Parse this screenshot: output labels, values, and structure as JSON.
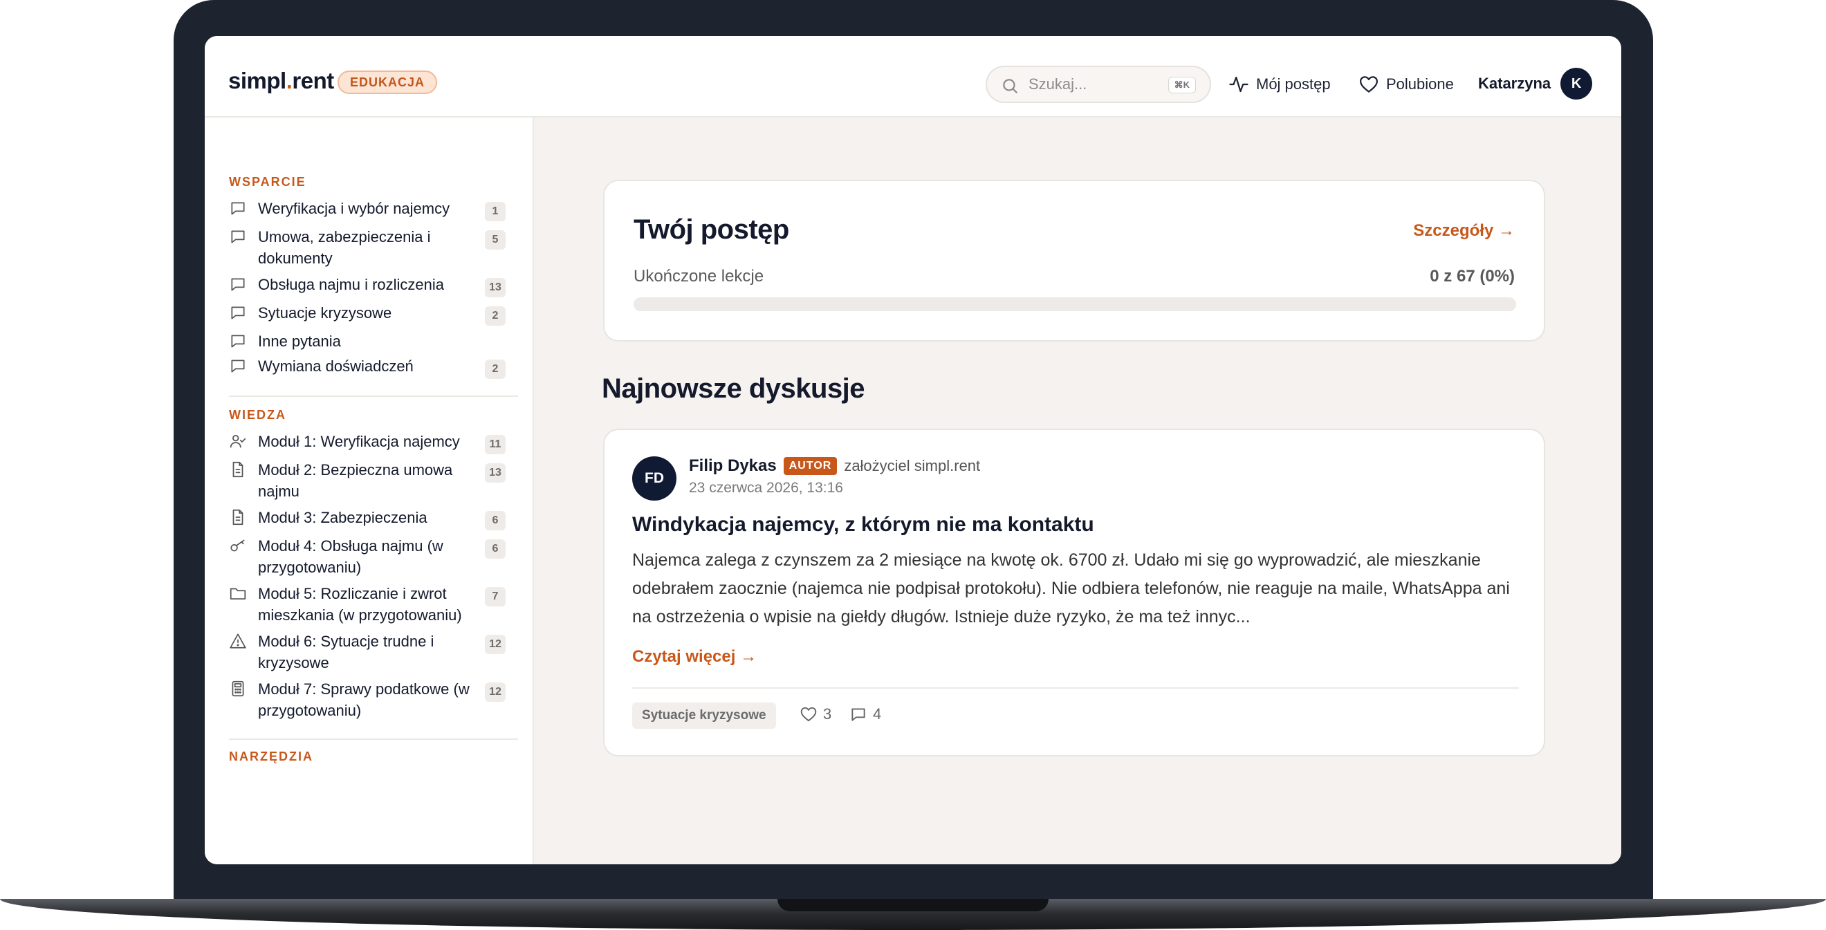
{
  "header": {
    "logo_main": "simpl",
    "logo_dot": ".",
    "logo_tail": "rent",
    "badge": "EDUKACJA",
    "search_placeholder": "Szukaj...",
    "search_shortcut": "⌘K",
    "nav_progress": "Mój postęp",
    "nav_favorites": "Polubione",
    "user_name": "Katarzyna",
    "user_initial": "K"
  },
  "sidebar": {
    "support": {
      "title": "WSPARCIE",
      "items": [
        {
          "label": "Weryfikacja i wybór najemcy",
          "count": "1"
        },
        {
          "label": "Umowa, zabezpieczenia i dokumenty",
          "count": "5"
        },
        {
          "label": "Obsługa najmu i rozliczenia",
          "count": "13"
        },
        {
          "label": "Sytuacje kryzysowe",
          "count": "2"
        },
        {
          "label": "Inne pytania",
          "count": ""
        },
        {
          "label": "Wymiana doświadczeń",
          "count": "2"
        }
      ]
    },
    "knowledge": {
      "title": "WIEDZA",
      "items": [
        {
          "label": "Moduł 1: Weryfikacja najemcy",
          "count": "11",
          "icon": "user-check-icon"
        },
        {
          "label": "Moduł 2: Bezpieczna umowa najmu",
          "count": "13",
          "icon": "document-icon"
        },
        {
          "label": "Moduł 3: Zabezpieczenia",
          "count": "6",
          "icon": "document-icon"
        },
        {
          "label": "Moduł 4: Obsługa najmu (w przygotowaniu)",
          "count": "6",
          "icon": "key-icon"
        },
        {
          "label": "Moduł 5: Rozliczanie i zwrot mieszkania (w przygotowaniu)",
          "count": "7",
          "icon": "folder-icon"
        },
        {
          "label": "Moduł 6: Sytuacje trudne i kryzysowe",
          "count": "12",
          "icon": "warning-icon"
        },
        {
          "label": "Moduł 7: Sprawy podatkowe (w przygotowaniu)",
          "count": "12",
          "icon": "calculator-icon"
        }
      ]
    },
    "tools": {
      "title": "NARZĘDZIA"
    }
  },
  "progress": {
    "title": "Twój postęp",
    "details_link": "Szczegóły →",
    "label": "Ukończone lekcje",
    "value": "0 z 67 (0%)",
    "fraction": 0
  },
  "discussions": {
    "title": "Najnowsze dyskusje",
    "post": {
      "initials": "FD",
      "author": "Filip Dykas",
      "badge": "AUTOR",
      "role": "założyciel simpl.rent",
      "date": "23 czerwca 2026, 13:16",
      "title": "Windykacja najemcy, z którym nie ma kontaktu",
      "excerpt": "Najemca zalega z czynszem za 2 miesiące na kwotę ok. 6700 zł. Udało mi się go wyprowadzić, ale mieszkanie odebrałem zaocznie (najemca nie podpisał protokołu). Nie odbiera telefonów, nie reaguje na maile, WhatsAppa ani na ostrzeżenia o wpisie na giełdy długów. Istnieje duże ryzyko, że ma też innyc...",
      "read_more": "Czytaj więcej →",
      "tag": "Sytuacje kryzysowe",
      "likes": "3",
      "comments": "4"
    }
  },
  "colors": {
    "accent": "#c8581a",
    "navy": "#111a33",
    "frame": "#1e2330",
    "main_bg": "#f6f2ef"
  }
}
